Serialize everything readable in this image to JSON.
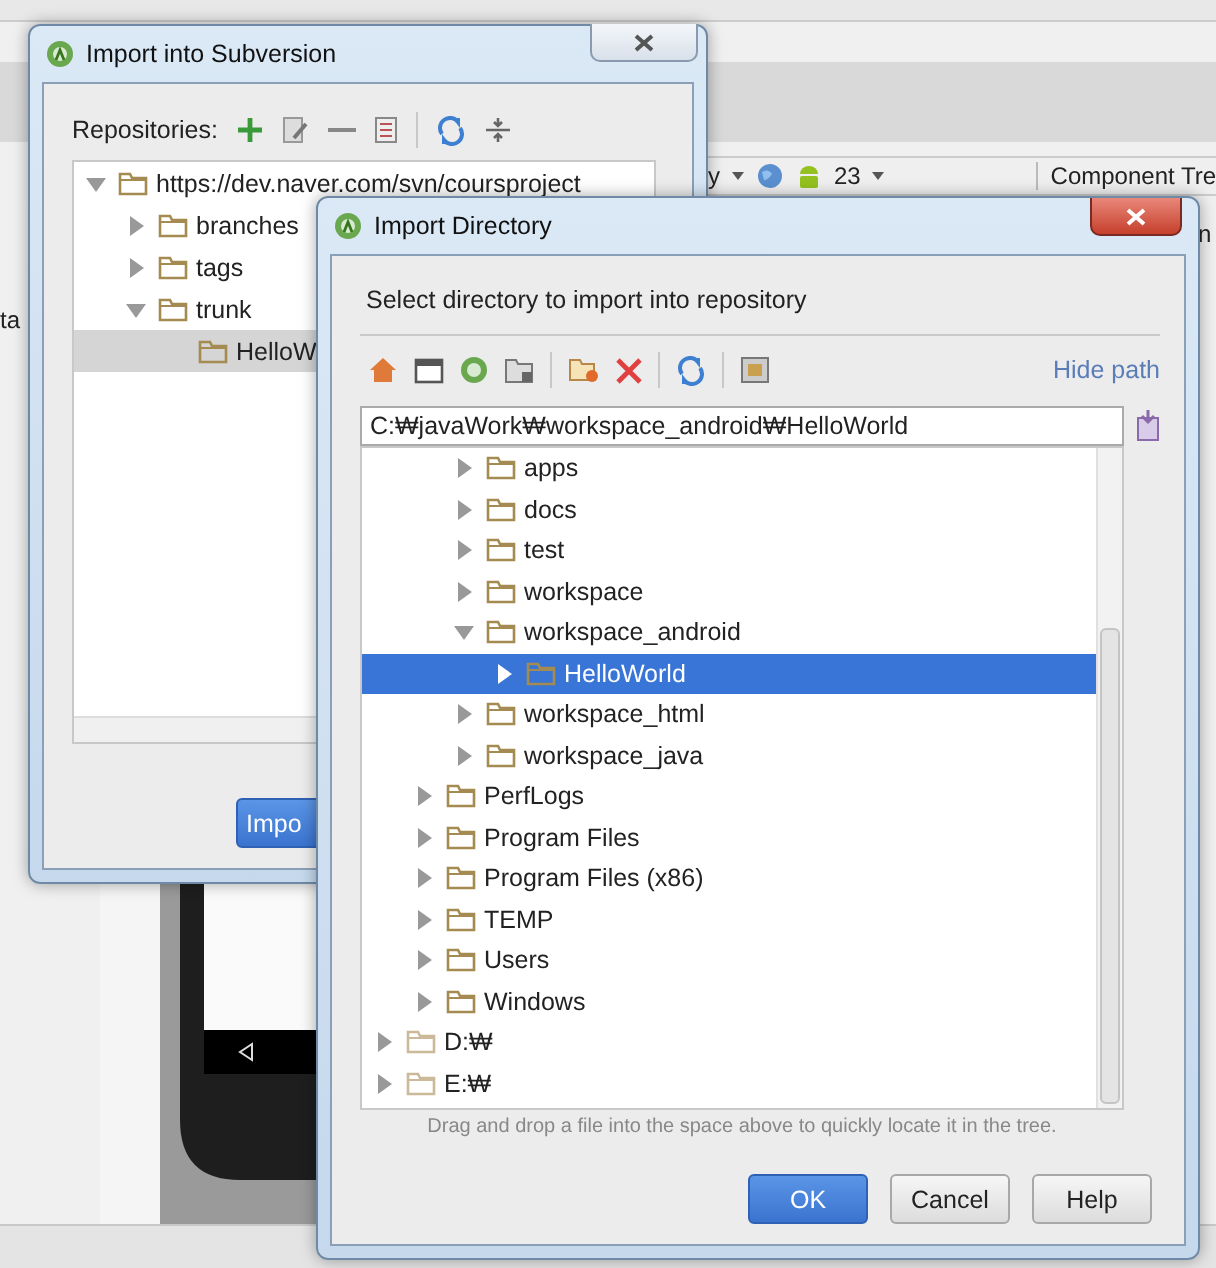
{
  "ide": {
    "left_text": "ta",
    "toolbar_items": [
      {
        "text": "y"
      },
      {
        "text": "23"
      }
    ],
    "panel_title": "Component Tre",
    "panel_text": "n"
  },
  "subversion_dialog": {
    "title": "Import into Subversion",
    "repositories_label": "Repositories:",
    "tree": [
      {
        "label": "https://dev.naver.com/svn/coursproject",
        "expanded": true,
        "selected": false,
        "children": [
          {
            "label": "branches",
            "expanded": false,
            "selected": false
          },
          {
            "label": "tags",
            "expanded": false,
            "selected": false
          },
          {
            "label": "trunk",
            "expanded": true,
            "selected": false,
            "children": [
              {
                "label": "HelloW",
                "selected": true
              }
            ]
          }
        ]
      }
    ],
    "import_button": "Impo"
  },
  "directory_dialog": {
    "title": "Import Directory",
    "prompt": "Select directory to import into repository",
    "hide_path": "Hide path",
    "path": "C:₩javaWork₩workspace_android₩HelloWorld",
    "tree": [
      {
        "children": [
          {
            "children": [
              {
                "label": "apps",
                "kind": "folder",
                "expanded": false,
                "selected": false
              },
              {
                "label": "docs",
                "kind": "folder",
                "expanded": false,
                "selected": false
              },
              {
                "label": "test",
                "kind": "folder",
                "expanded": false,
                "selected": false
              },
              {
                "label": "workspace",
                "kind": "folder",
                "expanded": false,
                "selected": false
              },
              {
                "label": "workspace_android",
                "kind": "folder",
                "expanded": true,
                "selected": false,
                "children": [
                  {
                    "label": "HelloWorld",
                    "kind": "folder",
                    "expanded": false,
                    "selected": true
                  }
                ]
              },
              {
                "label": "workspace_html",
                "kind": "folder",
                "expanded": false,
                "selected": false
              },
              {
                "label": "workspace_java",
                "kind": "folder",
                "expanded": false,
                "selected": false
              }
            ]
          },
          {
            "label": "PerfLogs",
            "kind": "folder",
            "expanded": false,
            "selected": false
          },
          {
            "label": "Program Files",
            "kind": "folder",
            "expanded": false,
            "selected": false
          },
          {
            "label": "Program Files (x86)",
            "kind": "folder",
            "expanded": false,
            "selected": false
          },
          {
            "label": "TEMP",
            "kind": "folder",
            "expanded": false,
            "selected": false
          },
          {
            "label": "Users",
            "kind": "folder",
            "expanded": false,
            "selected": false
          },
          {
            "label": "Windows",
            "kind": "folder",
            "expanded": false,
            "selected": false
          }
        ]
      },
      {
        "label": "D:₩",
        "kind": "drive",
        "expanded": false,
        "selected": false
      },
      {
        "label": "E:₩",
        "kind": "drive",
        "expanded": false,
        "selected": false
      }
    ],
    "hint": "Drag and drop a file into the space above to quickly locate it in the tree.",
    "buttons": [
      {
        "label": "OK",
        "primary": true
      },
      {
        "label": "Cancel",
        "primary": false
      },
      {
        "label": "Help",
        "primary": false
      }
    ]
  }
}
